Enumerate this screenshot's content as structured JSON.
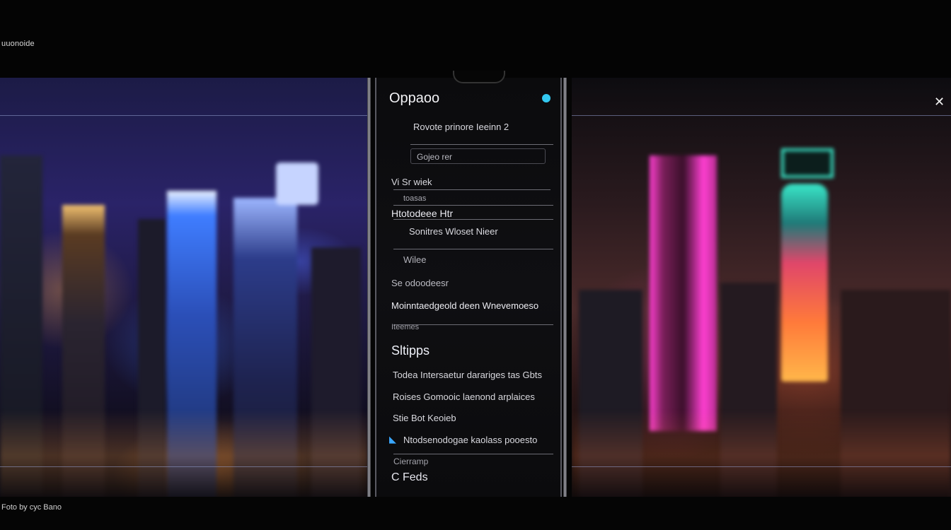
{
  "app": {
    "label": "uuonoide",
    "credit": "Foto by cyc Bano"
  },
  "menu": {
    "title": "Oppaoo",
    "items": [
      {
        "label": "Rovote prinore Ieeinn 2"
      },
      {
        "label": "Gojeo rer"
      },
      {
        "label": "Vi Sr wiek"
      },
      {
        "label": "toasas"
      },
      {
        "label": "Htotodeee Htr"
      },
      {
        "label": "Sonitres Wloset Nieer"
      },
      {
        "label": "Wilee"
      },
      {
        "label": "Se odoodeesr"
      },
      {
        "label": "Moinntaedgeold deen Wnevemoeso"
      },
      {
        "label": "Iteemes"
      }
    ],
    "section_title": "Sltipps",
    "section_items": [
      {
        "label": "Todea Intersaetur darariges tas Gbts"
      },
      {
        "label": "Roises Gomooic laenond arplaices"
      },
      {
        "label": "Stie Bot Keoieb"
      },
      {
        "label": "Ntodsenodogae kaolass pooesto"
      },
      {
        "label": "Cierramp"
      },
      {
        "label": "C Feds"
      }
    ]
  },
  "colors": {
    "accent": "#33c8f0",
    "link_accent": "#3aa7ff",
    "panel": "#0d0d10",
    "magenta": "#ff3fd2",
    "teal": "#39e6c8"
  },
  "icons": {
    "close": "close-icon",
    "status": "status-dot-icon"
  }
}
